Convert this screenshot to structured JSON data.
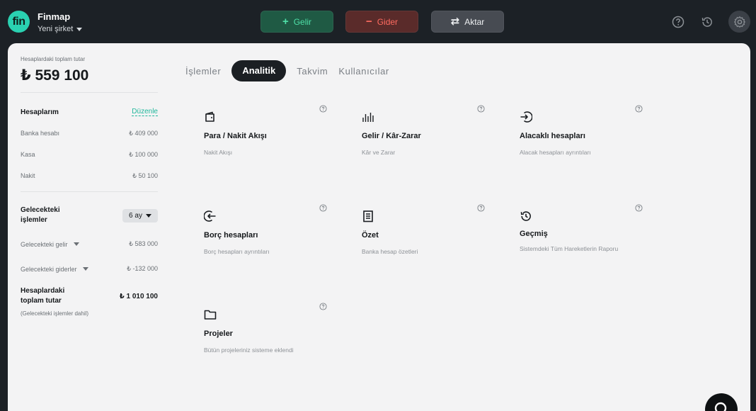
{
  "header": {
    "brand_name": "Finmap",
    "logo_text": "fin",
    "company": "Yeni şirket",
    "income_label": "Gelir",
    "income_symbol": "+",
    "expense_label": "Gider",
    "expense_symbol": "−",
    "transfer_label": "Aktar",
    "transfer_symbol": "⇄",
    "colors": {
      "income": "#4fe0a8",
      "expense": "#ff6b60",
      "accent": "#2ad1b1"
    }
  },
  "sidebar": {
    "total_label": "Hesaplardaki toplam tutar",
    "total_value": "₺ 559 100",
    "accounts_title": "Hesaplarım",
    "edit_label": "Düzenle",
    "accounts": [
      {
        "name": "Banka hesabı",
        "amount": "₺ 409 000"
      },
      {
        "name": "Kasa",
        "amount": "₺ 100 000"
      },
      {
        "name": "Nakit",
        "amount": "₺ 50 100"
      }
    ],
    "future_title": "Gelecekteki işlemler",
    "future_period": "6 ay",
    "future_income_label": "Gelecekteki gelir",
    "future_income_amount": "₺ 583 000",
    "future_expense_label": "Gelecekteki giderler",
    "future_expense_amount": "₺ -132 000",
    "grand_total_label": "Hesaplardaki toplam tutar",
    "grand_total_amount": "₺ 1 010 100",
    "grand_total_note": "(Gelecekteki işlemler dahil)"
  },
  "tabs": [
    {
      "label": "İşlemler",
      "active": false
    },
    {
      "label": "Analitik",
      "active": true
    },
    {
      "label": "Takvim",
      "active": false
    },
    {
      "label": "Kullanıcılar",
      "active": false
    }
  ],
  "reports": [
    {
      "icon": "wallet-icon",
      "title": "Para / Nakit Akışı",
      "desc": "Nakit Akışı"
    },
    {
      "icon": "bar-chart-icon",
      "title": "Gelir / Kâr-Zarar",
      "desc": "Kâr ve Zarar"
    },
    {
      "icon": "arrow-in-icon",
      "title": "Alacaklı hesapları",
      "desc": "Alacak hesapları ayrıntıları"
    },
    {
      "icon": "arrow-out-icon",
      "title": "Borç hesapları",
      "desc": "Borç hesapları ayrıntıları"
    },
    {
      "icon": "document-icon",
      "title": "Özet",
      "desc": "Banka hesap özetleri"
    },
    {
      "icon": "history-icon",
      "title": "Geçmiş",
      "desc": "Sistemdeki Tüm Hareketlerin Raporu"
    },
    {
      "icon": "folder-icon",
      "title": "Projeler",
      "desc": "Bütün projeleriniz sisteme eklendi"
    }
  ]
}
